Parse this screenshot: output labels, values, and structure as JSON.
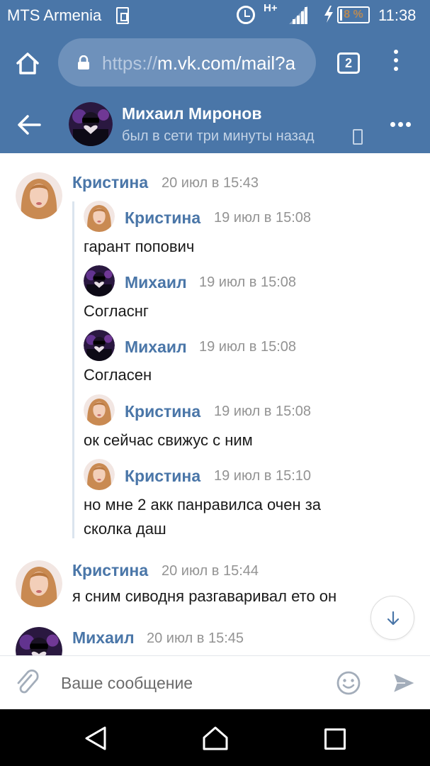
{
  "status_bar": {
    "carrier": "MTS Armenia",
    "network_type": "H+",
    "battery_percent": "8 %",
    "battery_level": 0.08,
    "time": "11:38",
    "icons": [
      "sim-icon",
      "alarm-icon",
      "signal-icon",
      "charging-icon",
      "battery-icon"
    ]
  },
  "browser": {
    "url_scheme": "https://",
    "url_rest": "m.vk.com/mail?a",
    "tab_count": "2",
    "icons": [
      "home-icon",
      "lock-icon",
      "tabs-icon",
      "more-vert-icon"
    ]
  },
  "chat_header": {
    "name": "Михаил Миронов",
    "status": "был в сети три минуты назад",
    "icons": [
      "back-arrow-icon",
      "mobile-phone-icon",
      "more-horiz-icon"
    ]
  },
  "messages": [
    {
      "sender": "Кристина",
      "time": "20 июл в 15:43",
      "avatar": "kristina",
      "forwarded": [
        {
          "sender": "Кристина",
          "time": "19 июл в 15:08",
          "avatar": "kristina",
          "text": "гарант попович"
        },
        {
          "sender": "Михаил",
          "time": "19 июл в 15:08",
          "avatar": "mikhail",
          "text": "Согласнг"
        },
        {
          "sender": "Михаил",
          "time": "19 июл в 15:08",
          "avatar": "mikhail",
          "text": "Согласен"
        },
        {
          "sender": "Кристина",
          "time": "19 июл в 15:08",
          "avatar": "kristina",
          "text": "ок сейчас свижус с ним"
        },
        {
          "sender": "Кристина",
          "time": "19 июл в 15:10",
          "avatar": "kristina",
          "text_lines": [
            "но мне 2 акк панравилса очен за",
            "сколка даш"
          ]
        }
      ]
    },
    {
      "sender": "Кристина",
      "time": "20 июл в 15:44",
      "avatar": "kristina",
      "text": "я сним сиводня разгаваривал ето он"
    },
    {
      "sender": "Михаил",
      "time": "20 июл в 15:45",
      "avatar": "mikhail"
    }
  ],
  "composer": {
    "placeholder": "Ваше сообщение",
    "icons": [
      "paperclip-icon",
      "emoji-icon",
      "send-icon"
    ]
  },
  "scroll_down": {
    "icon": "arrow-down-icon"
  },
  "nav_bar": {
    "icons": [
      "back-triangle-icon",
      "home-house-icon",
      "recents-square-icon"
    ]
  },
  "colors": {
    "vk_blue": "#4a76a8",
    "link_blue": "#4a76a8",
    "time_gray": "#939393",
    "text": "#1a1a1a",
    "forward_line": "#dbe4ee"
  }
}
